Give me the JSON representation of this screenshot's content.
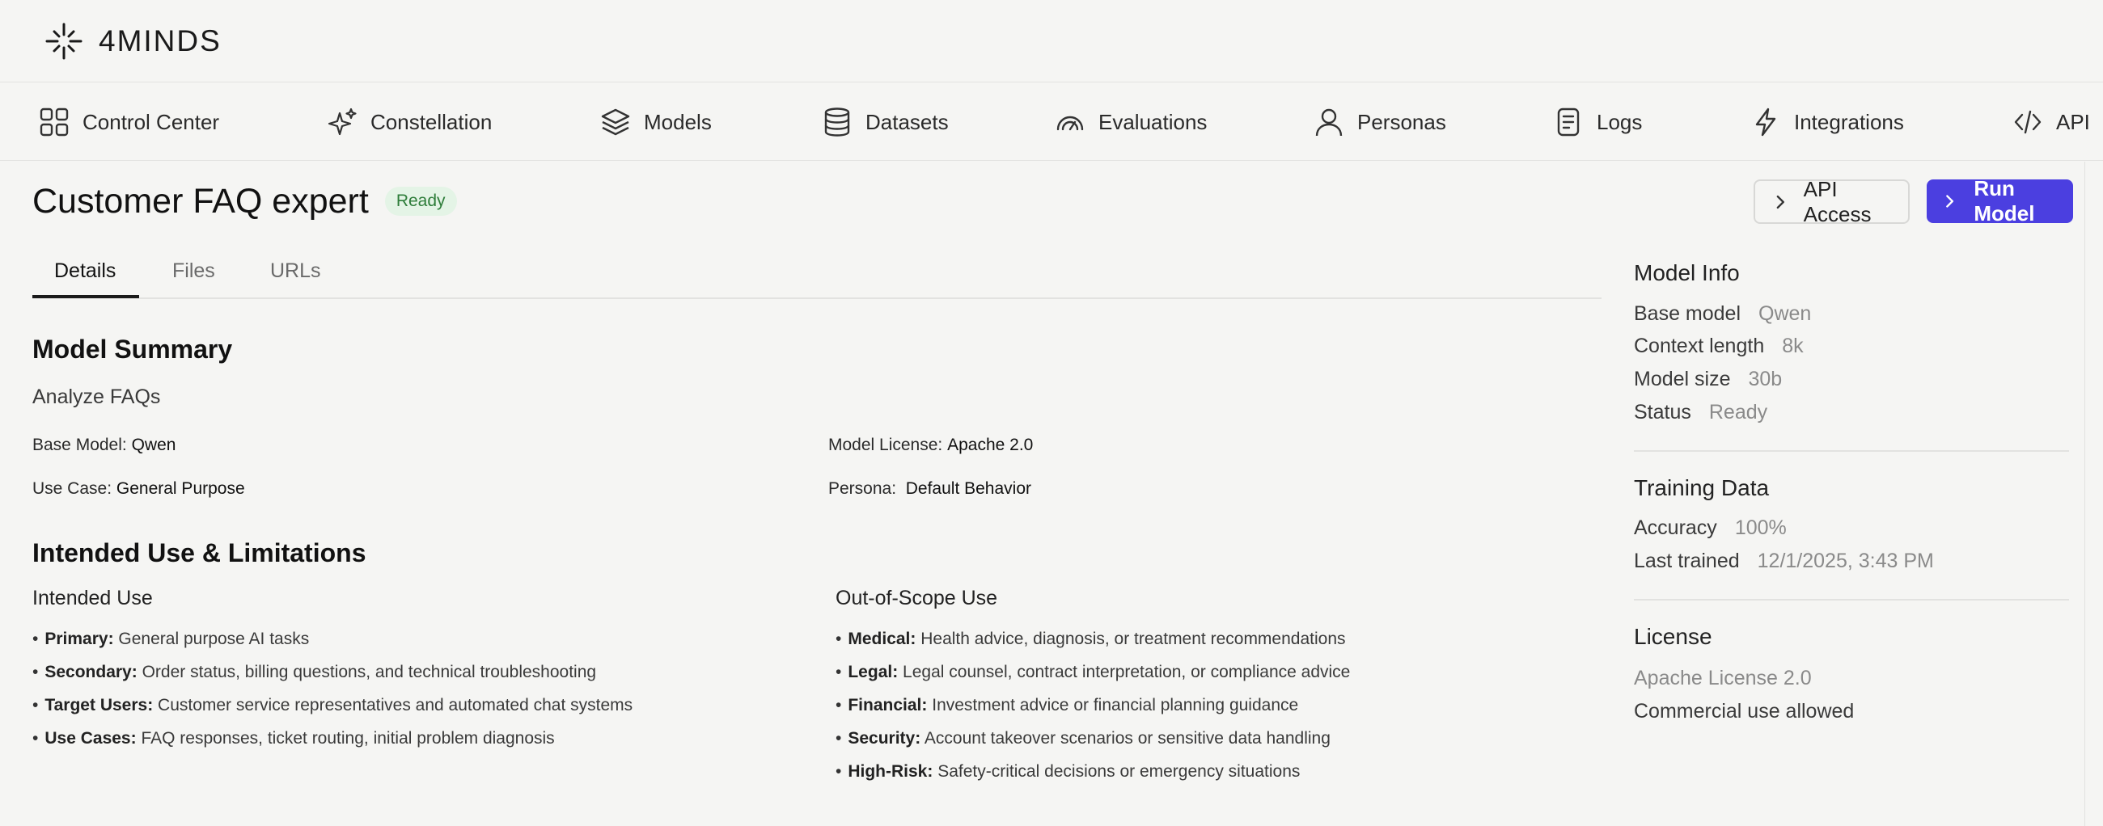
{
  "brand": {
    "name": "4MINDS"
  },
  "nav": [
    {
      "label": "Control Center",
      "icon": "grid-icon"
    },
    {
      "label": "Constellation",
      "icon": "sparkles-icon"
    },
    {
      "label": "Models",
      "icon": "layers-icon"
    },
    {
      "label": "Datasets",
      "icon": "database-icon"
    },
    {
      "label": "Evaluations",
      "icon": "gauge-icon"
    },
    {
      "label": "Personas",
      "icon": "user-icon"
    },
    {
      "label": "Logs",
      "icon": "document-icon"
    },
    {
      "label": "Integrations",
      "icon": "lightning-icon"
    },
    {
      "label": "API",
      "icon": "code-icon"
    }
  ],
  "page": {
    "title": "Customer FAQ expert",
    "status_badge": "Ready",
    "api_access_label": "API Access",
    "run_model_label": "Run Model"
  },
  "tabs": [
    {
      "label": "Details",
      "active": true
    },
    {
      "label": "Files",
      "active": false
    },
    {
      "label": "URLs",
      "active": false
    }
  ],
  "summary": {
    "heading": "Model Summary",
    "description": "Analyze FAQs",
    "base_model_key": "Base Model:",
    "base_model_val": "Qwen",
    "license_key": "Model License:",
    "license_val": "Apache 2.0",
    "use_case_key": "Use Case:",
    "use_case_val": "General Purpose",
    "persona_key": "Persona:",
    "persona_val": "Default Behavior"
  },
  "limitations": {
    "heading": "Intended Use & Limitations",
    "intended_heading": "Intended Use",
    "intended": [
      {
        "label": "Primary:",
        "text": "General purpose AI tasks"
      },
      {
        "label": "Secondary:",
        "text": "Order status, billing questions, and technical troubleshooting"
      },
      {
        "label": "Target Users:",
        "text": "Customer service representatives and automated chat systems"
      },
      {
        "label": "Use Cases:",
        "text": "FAQ responses, ticket routing, initial problem diagnosis"
      }
    ],
    "out_heading": "Out-of-Scope Use",
    "out_of_scope": [
      {
        "label": "Medical:",
        "text": "Health advice, diagnosis, or treatment recommendations"
      },
      {
        "label": "Legal:",
        "text": "Legal counsel, contract interpretation, or compliance advice"
      },
      {
        "label": "Financial:",
        "text": "Investment advice or financial planning guidance"
      },
      {
        "label": "Security:",
        "text": "Account takeover scenarios or sensitive data handling"
      },
      {
        "label": "High-Risk:",
        "text": "Safety-critical decisions or emergency situations"
      }
    ]
  },
  "sidebar": {
    "model_info_heading": "Model Info",
    "model_info": [
      {
        "key": "Base model",
        "value": "Qwen"
      },
      {
        "key": "Context length",
        "value": "8k"
      },
      {
        "key": "Model size",
        "value": "30b"
      },
      {
        "key": "Status",
        "value": "Ready"
      }
    ],
    "training_heading": "Training Data",
    "training": [
      {
        "key": "Accuracy",
        "value": "100%"
      },
      {
        "key": "Last trained",
        "value": "12/1/2025, 3:43 PM"
      }
    ],
    "license_heading": "License",
    "license_name": "Apache License 2.0",
    "license_note": "Commercial use allowed"
  },
  "colors": {
    "accent": "#4b3fe0",
    "badge_bg": "#e4f4e6",
    "badge_text": "#2e7d3a",
    "background": "#f5f5f3"
  }
}
